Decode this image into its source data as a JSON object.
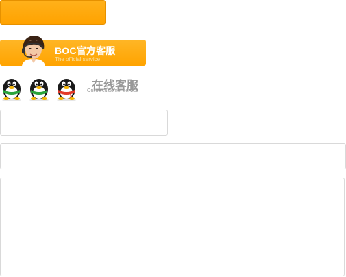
{
  "top_button": {
    "label": ""
  },
  "service_banner": {
    "title": "BOC官方客服",
    "subtitle": "The official service",
    "avatar_icon": "customer-service-agent-icon"
  },
  "qq_contacts": [
    {
      "icon": "qq-penguin-icon",
      "scarf_color": "#2aa33b"
    },
    {
      "icon": "qq-penguin-icon",
      "scarf_color": "#2aa33b"
    },
    {
      "icon": "qq-penguin-icon",
      "scarf_color": "#e23a2a"
    }
  ],
  "online_service": {
    "title": "在线客服",
    "subtitle": "Online customer service"
  },
  "form": {
    "field_1": {
      "value": "",
      "placeholder": ""
    },
    "field_2": {
      "value": "",
      "placeholder": ""
    },
    "message": {
      "value": "",
      "placeholder": ""
    }
  },
  "colors": {
    "accent": "#ffa500",
    "banner_text": "#ffffff",
    "muted_text": "#999999",
    "field_border": "#d9d9d9"
  }
}
